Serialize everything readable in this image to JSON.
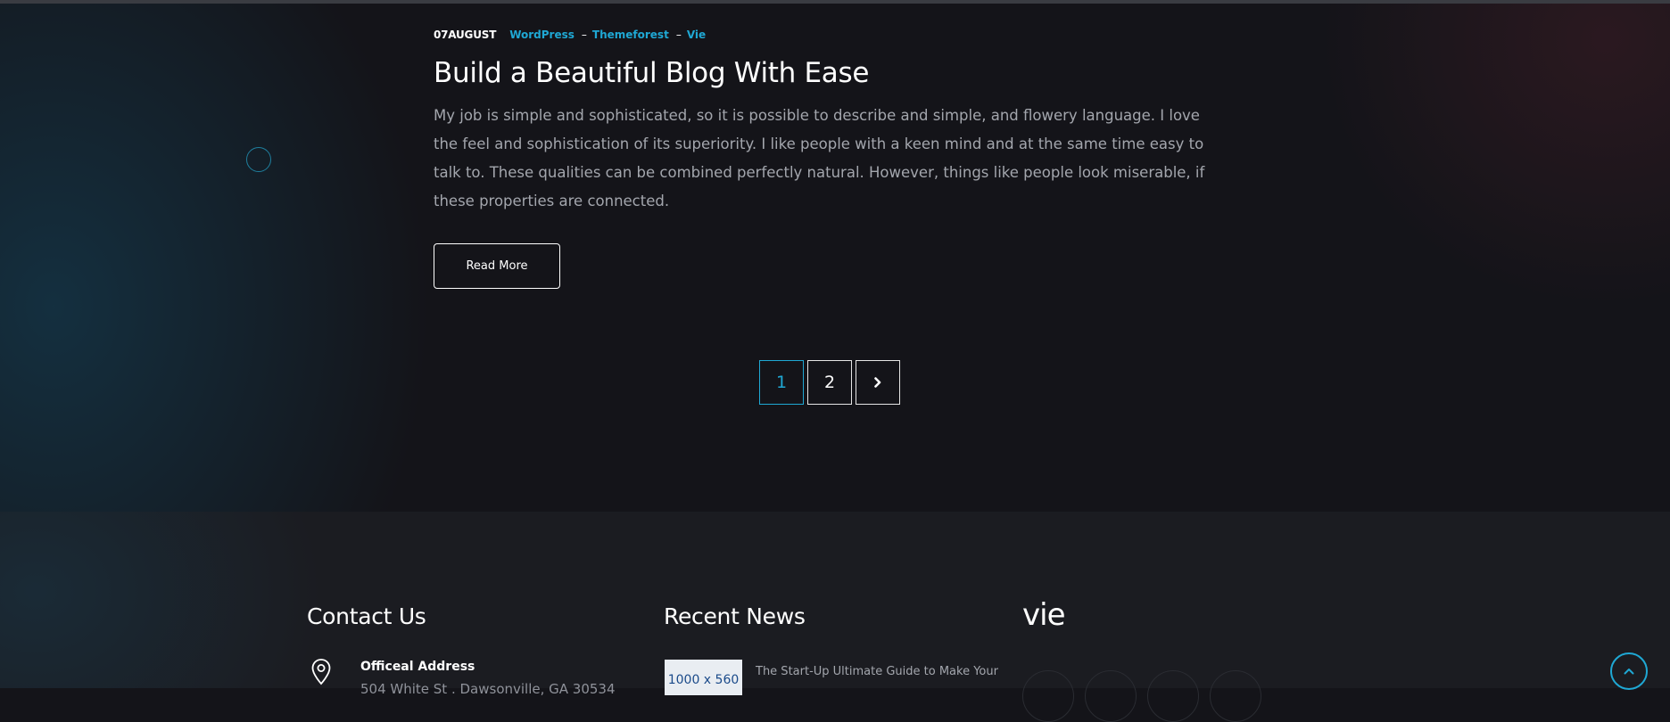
{
  "post": {
    "date": "07AUGUST",
    "tags": [
      "WordPress",
      "Themeforest",
      "Vie"
    ],
    "separator": "–",
    "title": "Build a Beautiful Blog With Ease",
    "excerpt": "My job is simple and sophisticated, so it is possible to describe and simple, and flowery language. I love the feel and sophistication of its superiority. I like people with a keen mind and at the same time easy to talk to. These qualities can be combined perfectly natural. However, things like people look miserable, if these properties are connected.",
    "read_more_label": "Read More"
  },
  "pagination": {
    "pages": [
      "1",
      "2"
    ],
    "active_page": "1",
    "next_icon": "chevron-right-icon"
  },
  "footer": {
    "contact": {
      "heading": "Contact Us",
      "address_label": "Officeal Address",
      "address_value": "504 White St . Dawsonville, GA 30534",
      "icon": "map-pin-icon"
    },
    "news": {
      "heading": "Recent News",
      "thumb_label": "1000 x 560",
      "item_title": "The Start-Up Ultimate Guide to Make Your"
    },
    "brand": {
      "logo_text": "vie"
    }
  },
  "colors": {
    "accent": "#1fa8d4",
    "background": "#141419",
    "footer_background": "#1b1c21",
    "body_text": "#a3a6ad"
  }
}
